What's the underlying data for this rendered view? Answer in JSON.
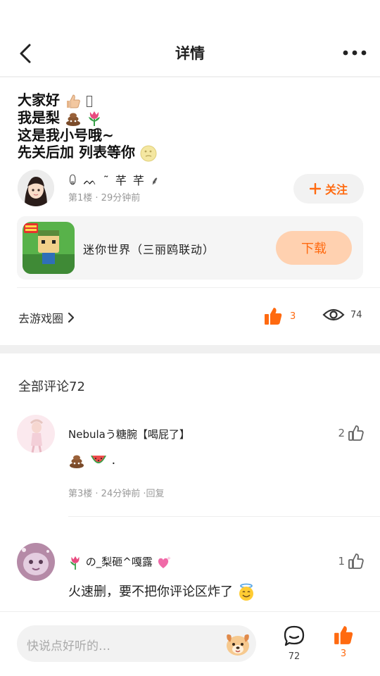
{
  "header": {
    "title": "详情"
  },
  "post": {
    "lines": [
      {
        "text": "大家好",
        "emoji": "thumbs-up-emoji"
      },
      {
        "text": "我是梨",
        "emoji": "poop-tulip-emoji"
      },
      {
        "text": "这是我小号哦~"
      },
      {
        "text": "先关后加  列表等你",
        "emoji": "moon-face-emoji"
      }
    ],
    "author": {
      "name": "ꐑ ᨓ ˜ 芊 芊 ⸙",
      "meta": "第1楼 · 29分钟前"
    },
    "follow_label": "关注",
    "game": {
      "name": "迷你世界（三丽鸥联动）",
      "download_label": "下载"
    },
    "goto_circle_label": "去游戏圈",
    "like_count": "3",
    "view_count": "74"
  },
  "comments": {
    "heading": "全部评论72",
    "items": [
      {
        "name": "Nebulaう糖腕【喝屁了】",
        "body": ".",
        "meta": "第3楼 · 24分钟前 ·回复",
        "likes": "2"
      },
      {
        "name": "の_梨砸^嘎露",
        "body": "火速删，要不把你评论区炸了",
        "likes": "1"
      }
    ]
  },
  "bottom_bar": {
    "input_placeholder": "快说点好听的…",
    "comment_count": "72",
    "like_count": "3"
  },
  "colors": {
    "accent": "#ff6a10",
    "download_bg": "#ffd1b0"
  }
}
